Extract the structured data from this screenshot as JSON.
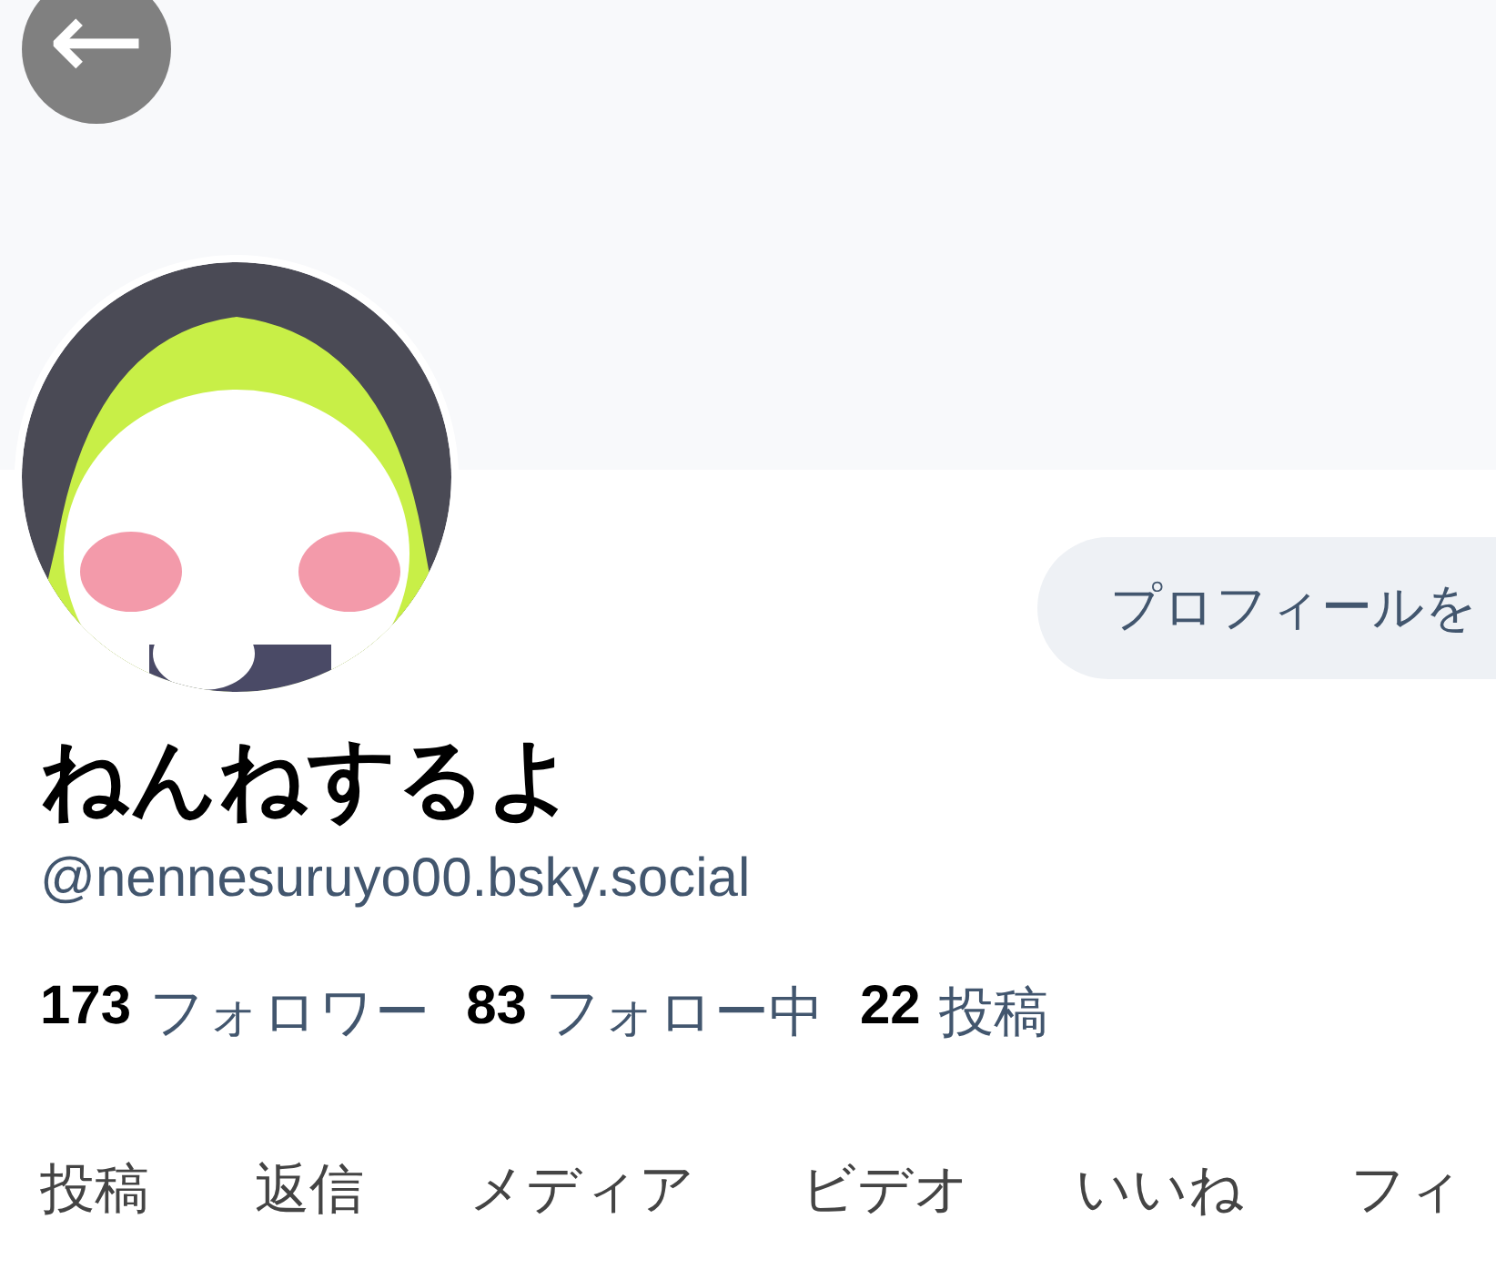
{
  "back_button": {
    "label": "←"
  },
  "edit_profile_button": {
    "label": "プロフィールを"
  },
  "profile": {
    "display_name": "ねんねするよ",
    "handle": "@nennesuruyo00.bsky.social"
  },
  "stats": [
    {
      "count": "173",
      "label": "フォロワー"
    },
    {
      "count": "83",
      "label": "フォロー中"
    },
    {
      "count": "22",
      "label": "投稿"
    }
  ],
  "tabs": [
    {
      "label": "投稿",
      "selected": false
    },
    {
      "label": "返信",
      "selected": false
    },
    {
      "label": "メディア",
      "selected": false
    },
    {
      "label": "ビデオ",
      "selected": false
    },
    {
      "label": "いいね",
      "selected": false
    },
    {
      "label": "フィ",
      "selected": false
    }
  ]
}
